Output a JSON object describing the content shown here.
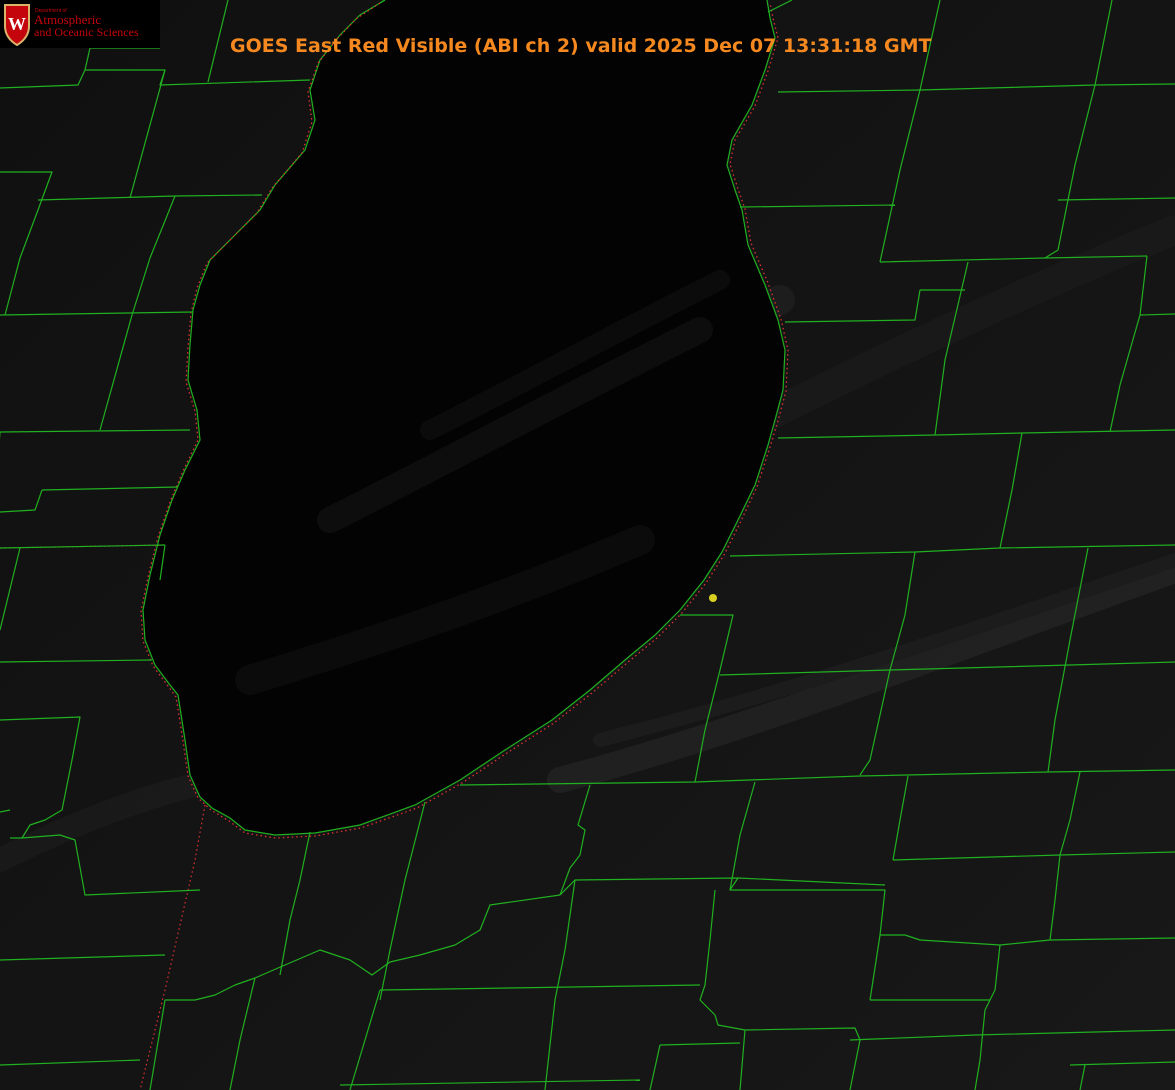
{
  "title": "GOES East Red Visible (ABI ch 2) valid 2025 Dec 07 13:31:18 GMT",
  "logo": {
    "department_label": "Department of",
    "line1": "Atmospheric",
    "line2": "and Oceanic Sciences",
    "crest_letter": "W"
  },
  "colors": {
    "title": "#f5891f",
    "county_lines": "#20b020",
    "shoreline_dotted": "#e03030",
    "station_marker": "#d8d020",
    "lake_water": "#030303",
    "land": "#121212",
    "logo_text": "#c5050c"
  },
  "map_layers": {
    "imagery": "visible satellite",
    "county_boundaries": "shown",
    "shoreline": "dotted red",
    "station_marker": "yellow dot"
  }
}
